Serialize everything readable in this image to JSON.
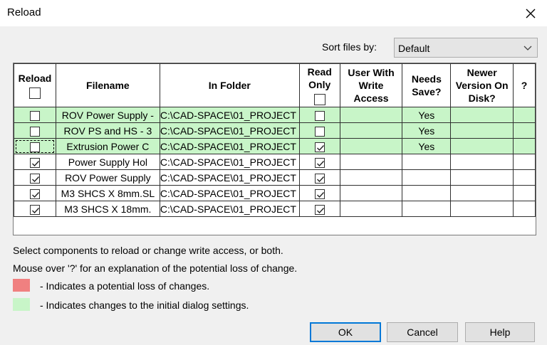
{
  "window": {
    "title": "Reload"
  },
  "sort": {
    "label": "Sort files by:",
    "value": "Default"
  },
  "columns": {
    "reload": "Reload",
    "filename": "Filename",
    "folder": "In Folder",
    "read_only": "Read Only",
    "write_access": "User With Write Access",
    "needs_save": "Needs Save?",
    "newer": "Newer Version On Disk?",
    "help": "?"
  },
  "rows": [
    {
      "reload": false,
      "filename": "ROV Power Supply -",
      "folder": "C:\\CAD-SPACE\\01_PROJECT",
      "read_only": false,
      "needs_save": "Yes",
      "changed": true
    },
    {
      "reload": false,
      "filename": "ROV PS and HS - 3",
      "folder": "C:\\CAD-SPACE\\01_PROJECT",
      "read_only": false,
      "needs_save": "Yes",
      "changed": true
    },
    {
      "reload": false,
      "filename": "Extrusion Power C",
      "folder": "C:\\CAD-SPACE\\01_PROJECT",
      "read_only": true,
      "needs_save": "Yes",
      "changed": true
    },
    {
      "reload": true,
      "filename": "Power Supply Hol",
      "folder": "C:\\CAD-SPACE\\01_PROJECT",
      "read_only": true,
      "needs_save": "",
      "changed": false
    },
    {
      "reload": true,
      "filename": "ROV Power Supply",
      "folder": "C:\\CAD-SPACE\\01_PROJECT",
      "read_only": true,
      "needs_save": "",
      "changed": false
    },
    {
      "reload": true,
      "filename": "M3 SHCS X 8mm.SL",
      "folder": "C:\\CAD-SPACE\\01_PROJECT",
      "read_only": true,
      "needs_save": "",
      "changed": false
    },
    {
      "reload": true,
      "filename": "M3 SHCS X 18mm.",
      "folder": "C:\\CAD-SPACE\\01_PROJECT",
      "read_only": true,
      "needs_save": "",
      "changed": false
    }
  ],
  "info": {
    "line1": "Select components to reload or change write access, or both.",
    "line2": "Mouse over '?' for an explanation of the potential loss of change."
  },
  "legend": {
    "loss": {
      "text": "- Indicates a potential loss of changes.",
      "color": "#f08080"
    },
    "changed": {
      "text": "- Indicates changes to the initial dialog settings.",
      "color": "#c8f5c8"
    }
  },
  "buttons": {
    "ok": "OK",
    "cancel": "Cancel",
    "help": "Help"
  }
}
